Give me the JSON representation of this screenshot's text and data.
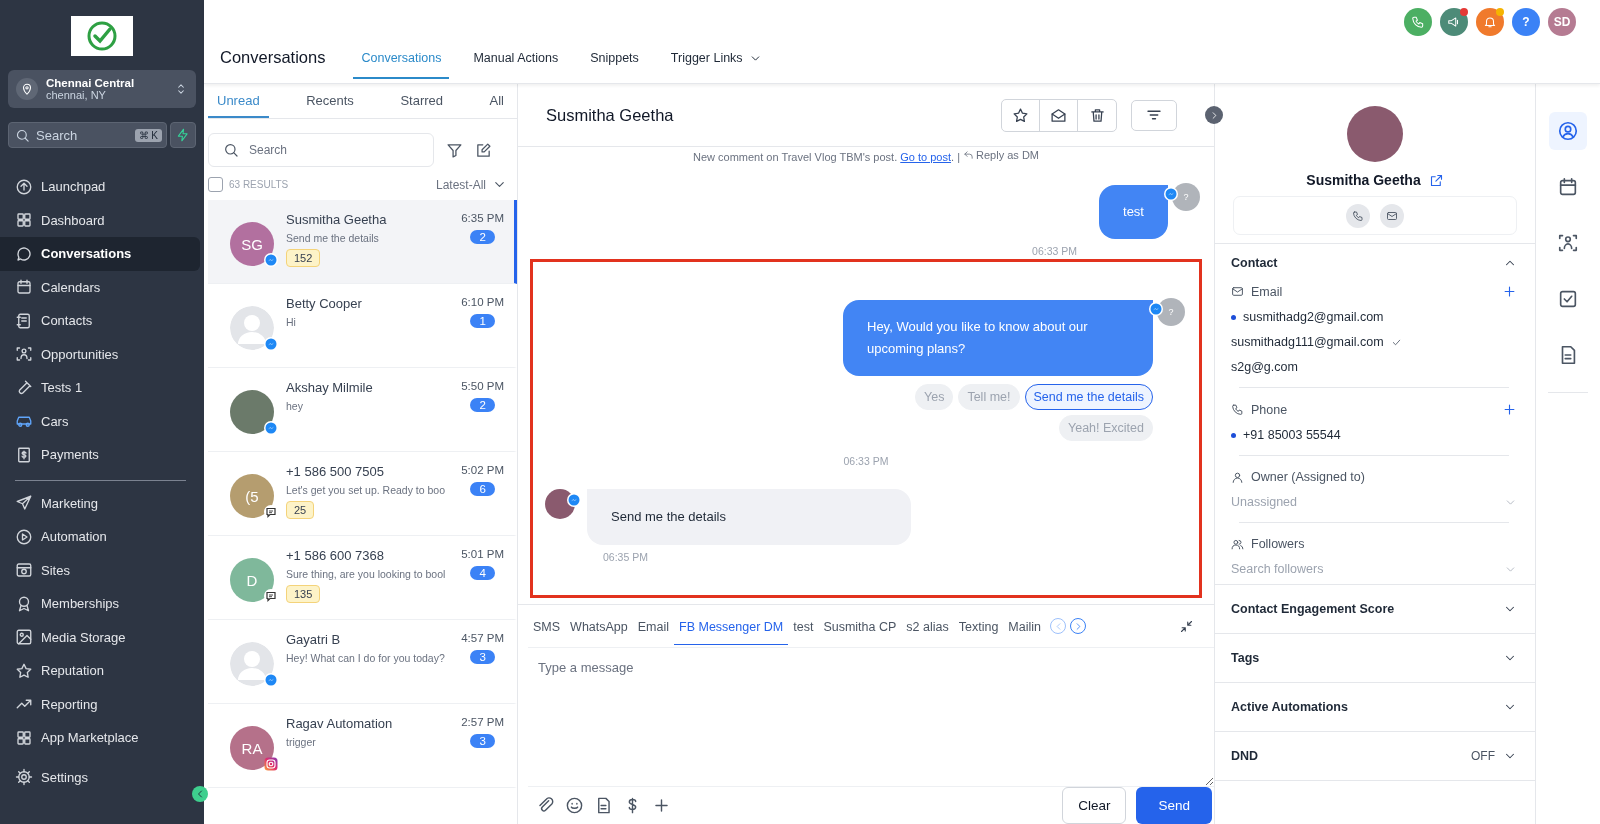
{
  "sidebar": {
    "location": {
      "name": "Chennai Central",
      "subtitle": "chennai, NY"
    },
    "search": {
      "placeholder": "Search",
      "shortcut": "⌘ K"
    },
    "nav_primary": [
      {
        "label": "Launchpad",
        "selected": false
      },
      {
        "label": "Dashboard",
        "selected": false
      },
      {
        "label": "Conversations",
        "selected": true
      },
      {
        "label": "Calendars",
        "selected": false
      },
      {
        "label": "Contacts",
        "selected": false
      },
      {
        "label": "Opportunities",
        "selected": false
      },
      {
        "label": "Tests 1",
        "selected": false
      },
      {
        "label": "Cars",
        "selected": false
      },
      {
        "label": "Payments",
        "selected": false
      }
    ],
    "nav_secondary": [
      {
        "label": "Marketing",
        "selected": false
      },
      {
        "label": "Automation",
        "selected": false
      },
      {
        "label": "Sites",
        "selected": false
      },
      {
        "label": "Memberships",
        "selected": false
      },
      {
        "label": "Media Storage",
        "selected": false
      },
      {
        "label": "Reputation",
        "selected": false
      },
      {
        "label": "Reporting",
        "selected": false
      },
      {
        "label": "App Marketplace",
        "selected": false
      },
      {
        "label": "Settings",
        "selected": false
      }
    ]
  },
  "header": {
    "title": "Conversations",
    "tabs": [
      {
        "label": "Conversations",
        "selected": true,
        "dropdown": false
      },
      {
        "label": "Manual Actions",
        "selected": false,
        "dropdown": false
      },
      {
        "label": "Snippets",
        "selected": false,
        "dropdown": false
      },
      {
        "label": "Trigger Links",
        "selected": false,
        "dropdown": true
      }
    ],
    "top_icons": [
      {
        "kind": "phone",
        "color": "#4caf63",
        "dot": false
      },
      {
        "kind": "megaphone",
        "color": "#4d8b78",
        "dot": true
      },
      {
        "kind": "bell",
        "color": "#f07a2c",
        "dot": true
      },
      {
        "kind": "help",
        "color": "#3b82f6",
        "dot": false,
        "text": "?"
      },
      {
        "kind": "avatar",
        "color": "#b57b92",
        "dot": false,
        "text": "SD"
      }
    ]
  },
  "list": {
    "tabs": [
      {
        "label": "Unread",
        "selected": true
      },
      {
        "label": "Recents",
        "selected": false
      },
      {
        "label": "Starred",
        "selected": false
      },
      {
        "label": "All",
        "selected": false
      }
    ],
    "search": {
      "placeholder": "Search"
    },
    "select_all": {
      "checked": false
    },
    "results": "63 RESULTS",
    "sort": "Latest-All",
    "conversations": [
      {
        "name": "Susmitha Geetha",
        "avatar": {
          "kind": "initials",
          "initials": "SG",
          "color": "#b2709f"
        },
        "channel": {
          "kind": "messenger"
        },
        "preview": "Send me the details",
        "time": "6:35 PM",
        "unread": "2",
        "tag": "152",
        "selected": true
      },
      {
        "name": "Betty Cooper",
        "avatar": {
          "kind": "silhouette"
        },
        "channel": {
          "kind": "messenger"
        },
        "preview": "Hi",
        "time": "6:10 PM",
        "unread": "1",
        "selected": false
      },
      {
        "name": "Akshay Milmile",
        "avatar": {
          "kind": "photo"
        },
        "channel": {
          "kind": "messenger"
        },
        "preview": "hey",
        "time": "5:50 PM",
        "unread": "2",
        "selected": false
      },
      {
        "name": "+1 586 500 7505",
        "avatar": {
          "kind": "initials",
          "initials": "(5",
          "color": "#b59d6f"
        },
        "channel": {
          "kind": "sms"
        },
        "preview": "Let's get you set up. Ready to boo",
        "time": "5:02 PM",
        "unread": "6",
        "tag": "25",
        "selected": false
      },
      {
        "name": "+1 586 600 7368",
        "avatar": {
          "kind": "initials",
          "initials": "D",
          "color": "#7fb89b"
        },
        "channel": {
          "kind": "sms"
        },
        "preview": "Sure thing, are you looking to bool",
        "time": "5:01 PM",
        "unread": "4",
        "tag": "135",
        "selected": false
      },
      {
        "name": "Gayatri B",
        "avatar": {
          "kind": "silhouette"
        },
        "channel": {
          "kind": "messenger"
        },
        "preview": "Hey! What can I do for you today?",
        "time": "4:57 PM",
        "unread": "3",
        "selected": false
      },
      {
        "name": "Ragav Automation",
        "avatar": {
          "kind": "initials",
          "initials": "RA",
          "color": "#b5718a"
        },
        "channel": {
          "kind": "instagram"
        },
        "preview": "trigger",
        "time": "2:57 PM",
        "unread": "3",
        "selected": false
      }
    ]
  },
  "chat": {
    "title": "Susmitha Geetha",
    "notice": {
      "text": "New comment on Travel Vlog TBM's post.",
      "link": "Go to post",
      "after": ".",
      "separator": "|",
      "reply": "Reply as DM"
    },
    "messages": [
      {
        "kind": "outgoing",
        "text": "test",
        "time": "06:33 PM",
        "avatar": "?"
      },
      {
        "kind": "outgoing",
        "text": "Hey, Would you like to know about our upcoming plans?",
        "time": "06:33 PM",
        "avatar": "?",
        "highlighted": true,
        "quick_replies": [
          {
            "label": "Yes",
            "selected": false
          },
          {
            "label": "Tell me!",
            "selected": false
          },
          {
            "label": "Send me the details",
            "selected": true
          },
          {
            "label": "Yeah! Excited",
            "selected": false
          }
        ]
      },
      {
        "kind": "incoming",
        "text": "Send me the details",
        "time": "06:35 PM",
        "highlighted": true
      }
    ],
    "composer": {
      "channels": [
        {
          "label": "SMS",
          "selected": false
        },
        {
          "label": "WhatsApp",
          "selected": false
        },
        {
          "label": "Email",
          "selected": false
        },
        {
          "label": "FB Messenger DM",
          "selected": true
        },
        {
          "label": "test",
          "selected": false
        },
        {
          "label": "Susmitha CP",
          "selected": false
        },
        {
          "label": "s2 alias",
          "selected": false
        },
        {
          "label": "Texting",
          "selected": false
        },
        {
          "label": "Mailin",
          "selected": false
        }
      ],
      "placeholder": "Type a message",
      "buttons": {
        "clear": "Clear",
        "send": "Send"
      }
    }
  },
  "contact": {
    "name": "Susmitha Geetha",
    "details": {
      "title": "Contact",
      "expanded": true,
      "email_label": "Email",
      "emails": [
        {
          "value": "susmithadg2@gmail.com",
          "primary": true,
          "verified": false
        },
        {
          "value": "susmithadg111@gmail.com",
          "primary": false,
          "verified": true
        },
        {
          "value": "s2g@g.com",
          "primary": false,
          "verified": false
        }
      ],
      "phone_label": "Phone",
      "phones": [
        {
          "value": "+91 85003 55544",
          "primary": true
        }
      ],
      "owner_label": "Owner (Assigned to)",
      "owner_placeholder": "Unassigned",
      "followers_label": "Followers",
      "followers_placeholder": "Search followers"
    },
    "sections": [
      {
        "title": "Contact Engagement Score",
        "expanded": false
      },
      {
        "title": "Tags",
        "expanded": false
      },
      {
        "title": "Active Automations",
        "expanded": false
      },
      {
        "title": "DND",
        "value": "OFF",
        "expanded": false
      }
    ],
    "rail": [
      {
        "selected": true
      },
      {
        "selected": false
      },
      {
        "selected": false
      },
      {
        "selected": false
      },
      {
        "selected": false
      }
    ]
  }
}
